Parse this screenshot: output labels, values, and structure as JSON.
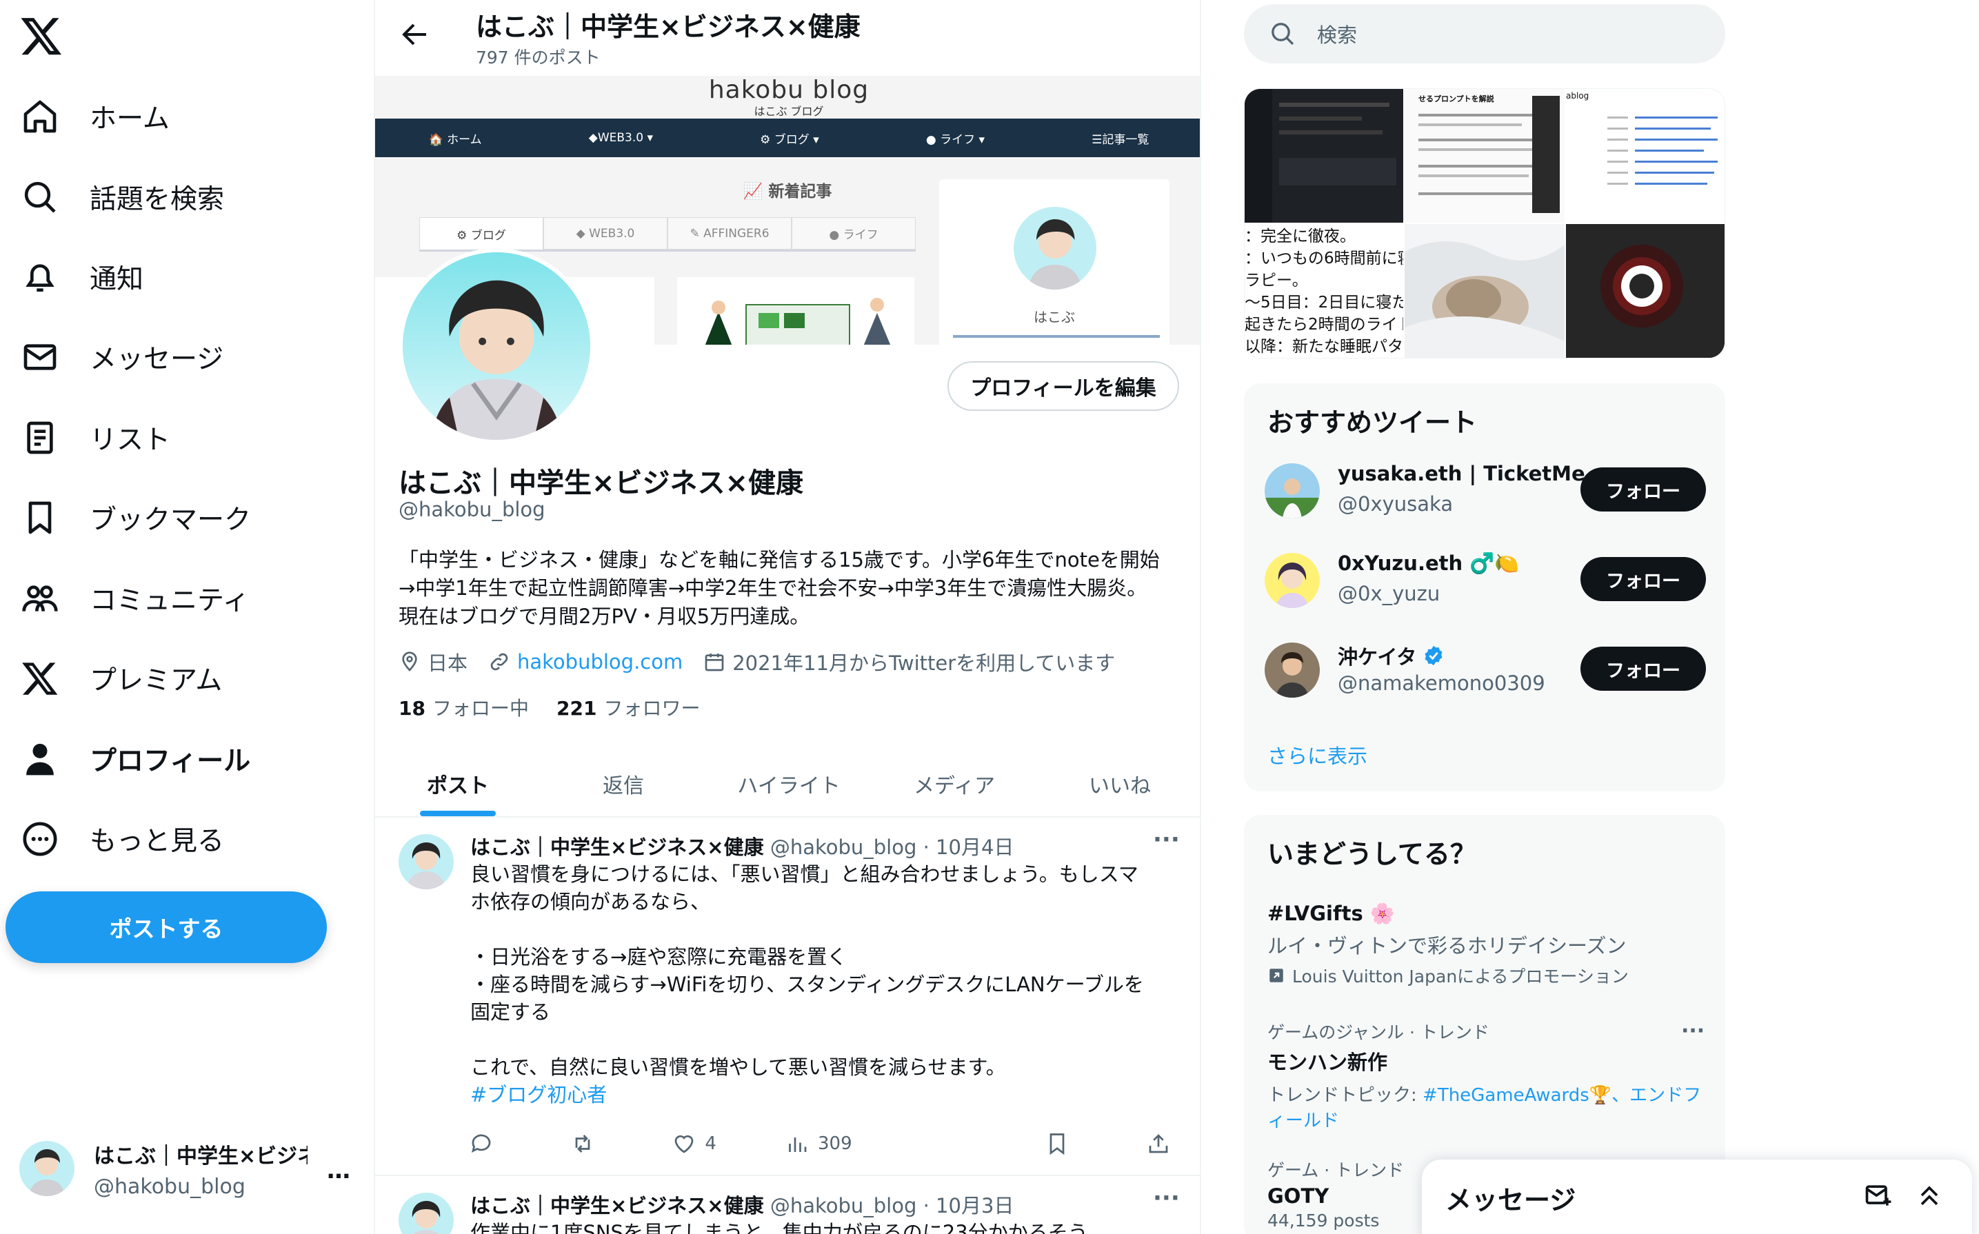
{
  "nav": {
    "items": [
      {
        "label": "ホーム",
        "icon": "home-icon"
      },
      {
        "label": "話題を検索",
        "icon": "search-icon"
      },
      {
        "label": "通知",
        "icon": "bell-icon"
      },
      {
        "label": "メッセージ",
        "icon": "mail-icon"
      },
      {
        "label": "リスト",
        "icon": "list-icon"
      },
      {
        "label": "ブックマーク",
        "icon": "bookmark-icon"
      },
      {
        "label": "コミュニティ",
        "icon": "community-icon"
      },
      {
        "label": "プレミアム",
        "icon": "x-logo-icon"
      },
      {
        "label": "プロフィール",
        "icon": "person-icon"
      },
      {
        "label": "もっと見る",
        "icon": "more-circle-icon"
      }
    ],
    "post_button": "ポストする",
    "account": {
      "name": "はこぶ｜中学生×ビジネ",
      "handle": "@hakobu_blog",
      "more": "…"
    }
  },
  "header": {
    "title": "はこぶ｜中学生×ビジネス×健康",
    "post_count": "797 件のポスト"
  },
  "banner": {
    "logo": "hakobu blog",
    "logo_sub": "はこぶ ブログ",
    "nav": [
      "🏠 ホーム",
      "◆WEB3.0 ▾",
      "⚙ ブログ ▾",
      "● ライフ ▾",
      "☰記事一覧"
    ],
    "new_articles": "新着記事",
    "tabs": [
      "⚙ ブログ",
      "◆ WEB3.0",
      "✎ AFFINGER6",
      "● ライフ"
    ],
    "profile_name": "はこぶ"
  },
  "profile": {
    "name": "はこぶ｜中学生×ビジネス×健康",
    "handle": "@hakobu_blog",
    "edit_button": "プロフィールを編集",
    "bio": [
      "「中学生・ビジネス・健康」などを軸に発信する15歳です。小学6年生でnoteを開始",
      "→中学1年生で起立性調節障害→中学2年生で社会不安→中学3年生で潰瘍性大腸炎。",
      "現在はブログで月間2万PV・月収5万円達成。"
    ],
    "location": "日本",
    "website": "hakobublog.com",
    "joined": "2021年11月からTwitterを利用しています",
    "following_count": "18",
    "following_label": "フォロー中",
    "followers_count": "221",
    "followers_label": "フォロワー"
  },
  "tabs": [
    "ポスト",
    "返信",
    "ハイライト",
    "メディア",
    "いいね"
  ],
  "tweets": [
    {
      "name": "はこぶ｜中学生×ビジネス×健康",
      "meta": "@hakobu_blog · 10月4日",
      "body": "良い習慣を身につけるには、「悪い習慣」と組み合わせましょう。もしスマ\nホ依存の傾向があるなら、\n\n・日光浴をする→庭や窓際に充電器を置く\n・座る時間を減らす→WiFiを切り、スタンディングデスクにLANケーブルを\n固定する\n\nこれで、自然に良い習慣を増やして悪い習慣を減らせます。",
      "hashtag": "#ブログ初心者",
      "likes": "4",
      "views": "309"
    },
    {
      "name": "はこぶ｜中学生×ビジネス×健康",
      "meta": "@hakobu_blog · 10月3日",
      "body": "作業中に1度SNSを見てしまうと、集中力が戻るのに23分かかるそう"
    }
  ],
  "search": {
    "placeholder": "検索"
  },
  "media_preview": {
    "thumb_heading": "せるプロンプトを解説",
    "thumb_blog": "ablog",
    "text_lines": [
      "：完全に徹夜。",
      "：いつもの6時間前に寝",
      "ラピー。",
      "〜5日目：2日目に寝た時",
      "起きたら2時間のライトセ",
      "以降：新たな睡眠パター"
    ]
  },
  "recommend": {
    "title": "おすすめツイート",
    "users": [
      {
        "name": "yusaka.eth | TicketMe",
        "handle": "@0xyusaka",
        "follow": "フォロー",
        "badge": ""
      },
      {
        "name": "0xYuzu.eth ♂️🍋",
        "handle": "@0x_yuzu",
        "follow": "フォロー",
        "badge": ""
      },
      {
        "name": "沖ケイタ",
        "handle": "@namakemono0309",
        "follow": "フォロー",
        "badge": "verified"
      }
    ],
    "show_more": "さらに表示"
  },
  "trends": {
    "title": "いまどうしてる？",
    "items": [
      {
        "name": "#LVGifts 🌸",
        "desc": "ルイ・ヴィトンで彩るホリデイシーズン",
        "promo": "Louis Vuitton Japanによるプロモーション"
      },
      {
        "category": "ゲームのジャンル · トレンド",
        "name": "モンハン新作",
        "topic_prefix": "トレンドトピック: ",
        "topic_link": "#TheGameAwards🏆、エンドフ",
        "topic_line2": "ィールド"
      },
      {
        "category": "ゲーム · トレンド",
        "name": "GOTY",
        "count": "44,159 posts"
      }
    ]
  },
  "messages": {
    "title": "メッセージ"
  },
  "colors": {
    "accent": "#1d9bf0",
    "text": "#0f1419",
    "muted": "#536471",
    "banner_nav": "#1a3146"
  }
}
